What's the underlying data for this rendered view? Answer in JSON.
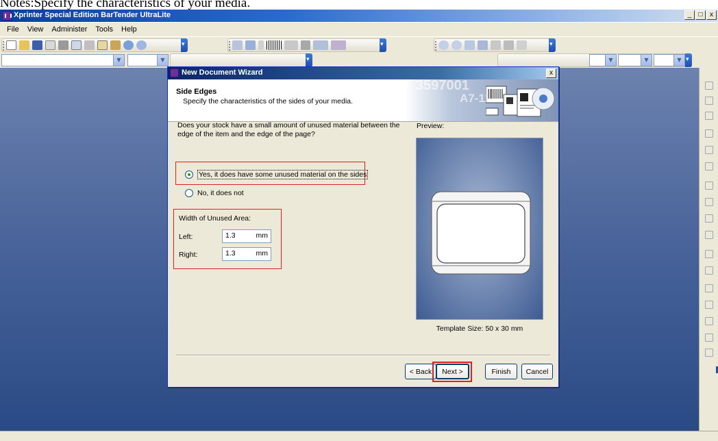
{
  "note_text": "Notes:Specify the characteristics of your media.",
  "app": {
    "title": "Xprinter Special Edition BarTender UltraLite",
    "window_controls": [
      "_",
      "□",
      "x"
    ]
  },
  "menu": [
    "File",
    "View",
    "Administer",
    "Tools",
    "Help"
  ],
  "dialog": {
    "title": "New Document Wizard",
    "close_label": "x",
    "header_title": "Side Edges",
    "header_subtitle": "Specify the characteristics of the sides of your media.",
    "banner_numbers": [
      "3597001",
      "A7-118"
    ],
    "question": "Does your stock have a small amount of unused material between the edge of the item and the edge of the page?",
    "option_yes": "Yes, it does have some unused material on the sides",
    "option_no": "No, it does not",
    "selected_option": "yes",
    "unused_area_label": "Width of Unused Area:",
    "left_label": "Left:",
    "left_value": "1.3",
    "left_unit": "mm",
    "right_label": "Right:",
    "right_value": "1.3",
    "right_unit": "mm",
    "preview_label": "Preview:",
    "template_size": "Template Size:  50 x 30 mm",
    "buttons": {
      "back": "< Back",
      "next": "Next >",
      "finish": "Finish",
      "cancel": "Cancel"
    }
  },
  "colors": {
    "highlight": "#e02020",
    "title_bar": "#0a246a",
    "workspace": "#48639a"
  }
}
